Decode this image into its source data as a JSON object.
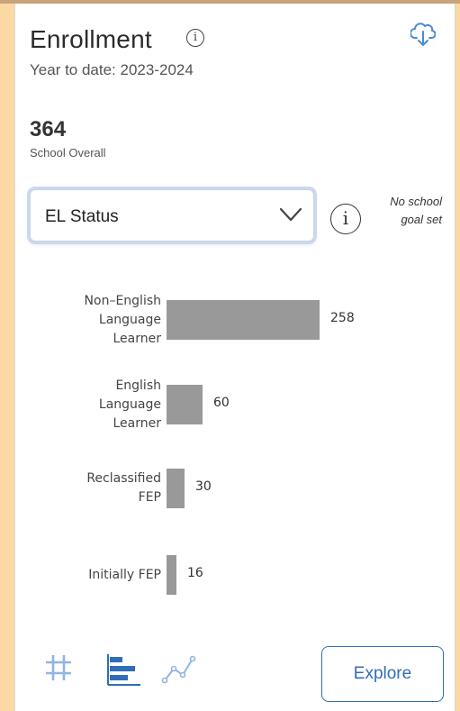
{
  "card": {
    "title": "Enrollment",
    "subtitle": "Year to date: 2023-2024",
    "total_value": "364",
    "total_label": "School Overall"
  },
  "filter": {
    "selected": "EL Status"
  },
  "goal_note": "No school goal set",
  "icons": {
    "info": "info-icon",
    "download": "cloud-download-icon",
    "chevron": "chevron-down-icon",
    "number_view": "hash-icon",
    "bar_view": "bar-chart-icon",
    "line_view": "line-chart-icon"
  },
  "explore_label": "Explore",
  "colors": {
    "bar": "#999999",
    "accent": "#2f6eb5",
    "background": "#fcd9a3"
  },
  "chart_data": {
    "type": "bar",
    "orientation": "horizontal",
    "categories": [
      "Non–English Language Learner",
      "English Language Learner",
      "Reclassified FEP",
      "Initially FEP"
    ],
    "values": [
      258,
      60,
      30,
      16
    ],
    "title": "",
    "xlabel": "",
    "ylabel": ""
  }
}
